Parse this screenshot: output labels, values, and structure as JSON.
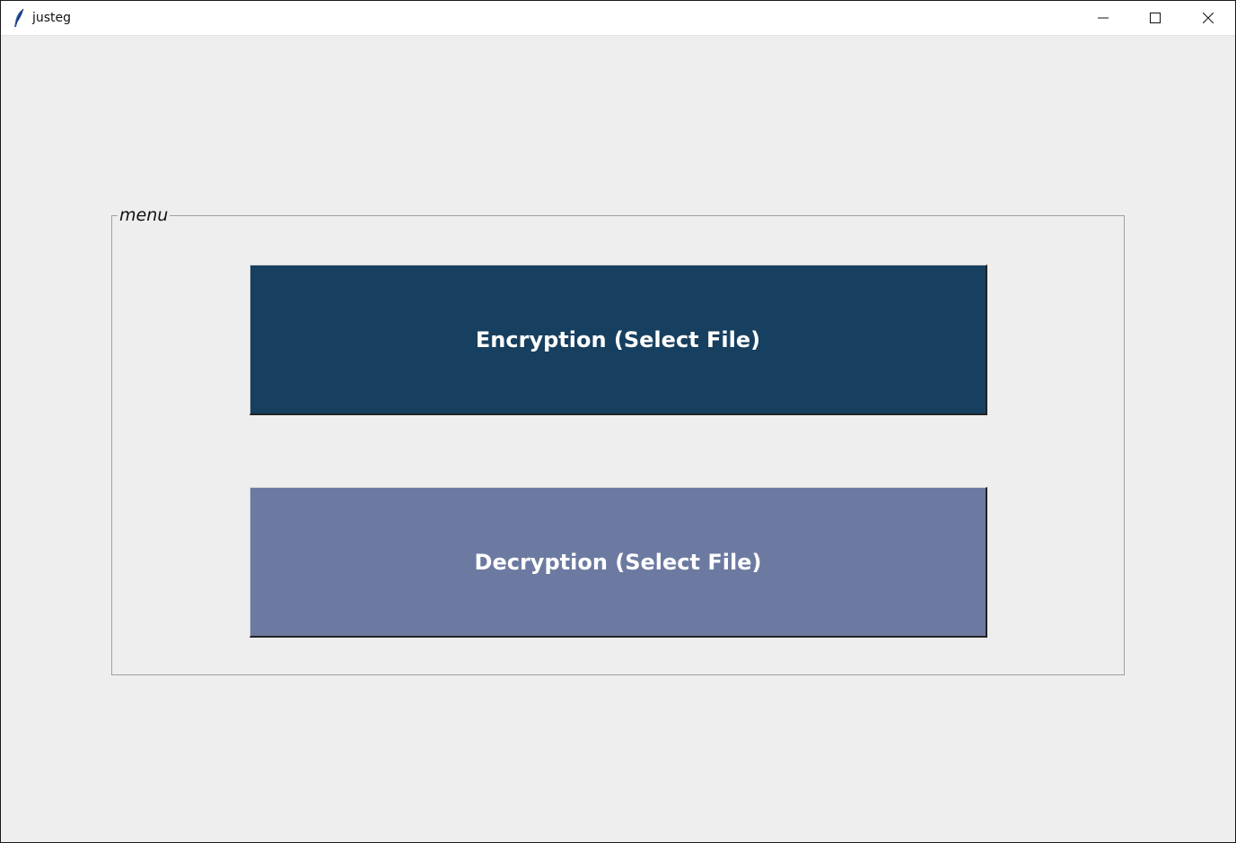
{
  "window": {
    "title": "justeg",
    "controls": {
      "minimize_icon": "minimize-icon",
      "maximize_icon": "maximize-icon",
      "close_icon": "close-icon"
    }
  },
  "menu": {
    "legend": "menu",
    "encrypt_button": {
      "label": "Encryption (Select File)",
      "color": "#173f5f"
    },
    "decrypt_button": {
      "label": "Decryption (Select File)",
      "color": "#6c7aa1"
    }
  },
  "colors": {
    "background": "#eeeeee",
    "frame_border": "#a0a0a0"
  }
}
